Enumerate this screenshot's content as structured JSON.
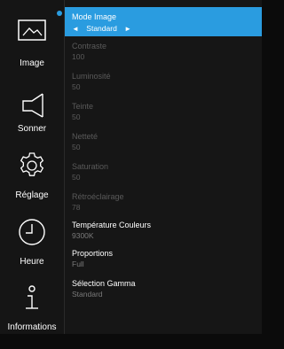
{
  "sidebar": {
    "items": [
      {
        "label": "Image",
        "icon": "image-icon"
      },
      {
        "label": "Sonner",
        "icon": "speaker-icon"
      },
      {
        "label": "Réglage",
        "icon": "gear-icon"
      },
      {
        "label": "Heure",
        "icon": "clock-icon"
      },
      {
        "label": "Informations",
        "icon": "info-icon"
      }
    ]
  },
  "settings": {
    "picture_mode": {
      "title": "Mode Image",
      "value": "Standard",
      "left_arrow": "◄",
      "right_arrow": "►"
    },
    "contrast": {
      "title": "Contraste",
      "value": "100"
    },
    "brightness": {
      "title": "Luminosité",
      "value": "50"
    },
    "hue": {
      "title": "Teinte",
      "value": "50"
    },
    "sharpness": {
      "title": "Netteté",
      "value": "50"
    },
    "saturation": {
      "title": "Saturation",
      "value": "50"
    },
    "backlight": {
      "title": "Rétroéclairage",
      "value": "78"
    },
    "color_temp": {
      "title": "Température Couleurs",
      "value": "9300K"
    },
    "aspect": {
      "title": "Proportions",
      "value": "Full"
    },
    "gamma": {
      "title": "Sélection Gamma",
      "value": "Standard"
    }
  },
  "colors": {
    "accent": "#2a9ce0",
    "background": "#161616",
    "disabled_text": "#5a5a5a"
  }
}
